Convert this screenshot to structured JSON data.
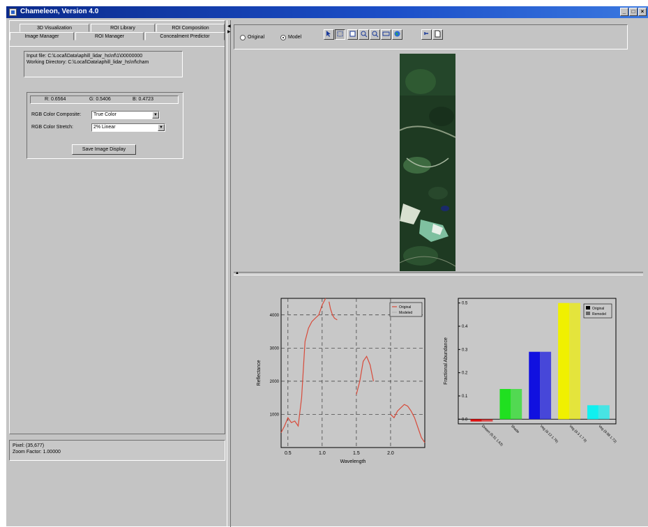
{
  "window": {
    "title": "Chameleon, Version 4.0",
    "controls": [
      "_",
      "□",
      "×"
    ]
  },
  "left_panel": {
    "tabs_row1": [
      "3D Visualization",
      "ROI Library",
      "ROI Composition"
    ],
    "tabs_row2": [
      "Image Manager",
      "ROI Manager",
      "Concealment Predictor"
    ],
    "active_tab": "Image Manager",
    "input_file": "Input file: C:\\Local\\Data\\aphill_lidar_hs\\nf\\1\\00000000",
    "working_directory": "Working Directory: C:\\Local\\Data\\aphill_lidar_hs\\nf\\cham",
    "rgb_values": {
      "r": "R: 0.6564",
      "g": "G: 0.5406",
      "b": "B: 0.4723"
    },
    "color_composite_label": "RGB Color Composite:",
    "color_composite_value": "True Color",
    "color_stretch_label": "RGB Color Stretch:",
    "color_stretch_value": "2% Linear",
    "save_button": "Save Image Display",
    "status": {
      "pixel": "Pixel: (35,677)",
      "zoom": "Zoom Factor: 1.00000"
    }
  },
  "toolbar": {
    "radio_original": "Original",
    "radio_model": "Model",
    "selected": "Model",
    "tools": [
      "pointer-icon",
      "select-icon",
      "crop-icon",
      "zoom-in-icon",
      "zoom-out-icon",
      "fit-icon",
      "globe-icon",
      "undo-icon",
      "page-icon"
    ]
  },
  "colors": {
    "titlebar": "#0a2a8c",
    "face": "#c4c4c4",
    "original_line": "#d84a3a",
    "model_line": "#b0b0b0"
  },
  "chart_data": [
    {
      "type": "line",
      "xlabel": "Wavelength",
      "ylabel": "Reflectance",
      "xlim": [
        0.4,
        2.5
      ],
      "ylim": [
        0,
        4500
      ],
      "xticks": [
        0.5,
        1.0,
        1.5,
        2.0
      ],
      "xtick_labels": [
        "0.5",
        "1.0",
        "1.5",
        "2.0"
      ],
      "yticks": [
        1000,
        2000,
        3000,
        4000
      ],
      "ytick_labels": [
        "1000",
        "2000",
        "3000",
        "4000"
      ],
      "grid": true,
      "legend": "top-right",
      "series": [
        {
          "name": "Original",
          "segments": [
            [
              [
                0.4,
                450
              ],
              [
                0.45,
                650
              ],
              [
                0.5,
                900
              ],
              [
                0.55,
                750
              ],
              [
                0.6,
                800
              ],
              [
                0.65,
                650
              ],
              [
                0.7,
                1500
              ],
              [
                0.75,
                3200
              ],
              [
                0.8,
                3600
              ],
              [
                0.85,
                3800
              ],
              [
                0.9,
                3900
              ],
              [
                0.95,
                4000
              ],
              [
                1.0,
                4300
              ],
              [
                1.05,
                4500
              ]
            ],
            [
              [
                1.1,
                4400
              ],
              [
                1.12,
                4200
              ],
              [
                1.15,
                4000
              ],
              [
                1.18,
                3900
              ],
              [
                1.22,
                3850
              ]
            ],
            [
              [
                1.5,
                1600
              ],
              [
                1.55,
                2000
              ],
              [
                1.6,
                2600
              ],
              [
                1.65,
                2750
              ],
              [
                1.7,
                2500
              ],
              [
                1.75,
                2000
              ]
            ],
            [
              [
                2.0,
                1000
              ],
              [
                2.05,
                900
              ],
              [
                2.1,
                1100
              ],
              [
                2.15,
                1200
              ],
              [
                2.2,
                1300
              ],
              [
                2.25,
                1250
              ],
              [
                2.3,
                1100
              ],
              [
                2.35,
                900
              ],
              [
                2.4,
                600
              ],
              [
                2.45,
                300
              ],
              [
                2.5,
                150
              ]
            ]
          ]
        },
        {
          "name": "Modeled",
          "segments": []
        }
      ]
    },
    {
      "type": "bar",
      "ylabel": "Fractional Abundance",
      "ylim": [
        -0.02,
        0.52
      ],
      "yticks": [
        0.0,
        0.1,
        0.2,
        0.3,
        0.4,
        0.5
      ],
      "ytick_labels": [
        "0.0",
        "0.1",
        "0.2",
        "0.3",
        "0.4",
        "0.5"
      ],
      "categories": [
        "Dream (0.31 1.63)",
        "Shade",
        "Veg (0.12 1.76)",
        "Veg (0.3 1.7 0)",
        "Veg (0.08 1.73)"
      ],
      "category_colors": [
        "#e01010",
        "#20e020",
        "#1010e0",
        "#f0f000",
        "#10f0f0"
      ],
      "legend": "top-right",
      "series": [
        {
          "name": "Original",
          "values": [
            -0.01,
            0.13,
            0.29,
            0.5,
            0.06
          ]
        },
        {
          "name": "Remodel",
          "values": [
            -0.01,
            0.13,
            0.29,
            0.5,
            0.06
          ]
        }
      ]
    }
  ]
}
